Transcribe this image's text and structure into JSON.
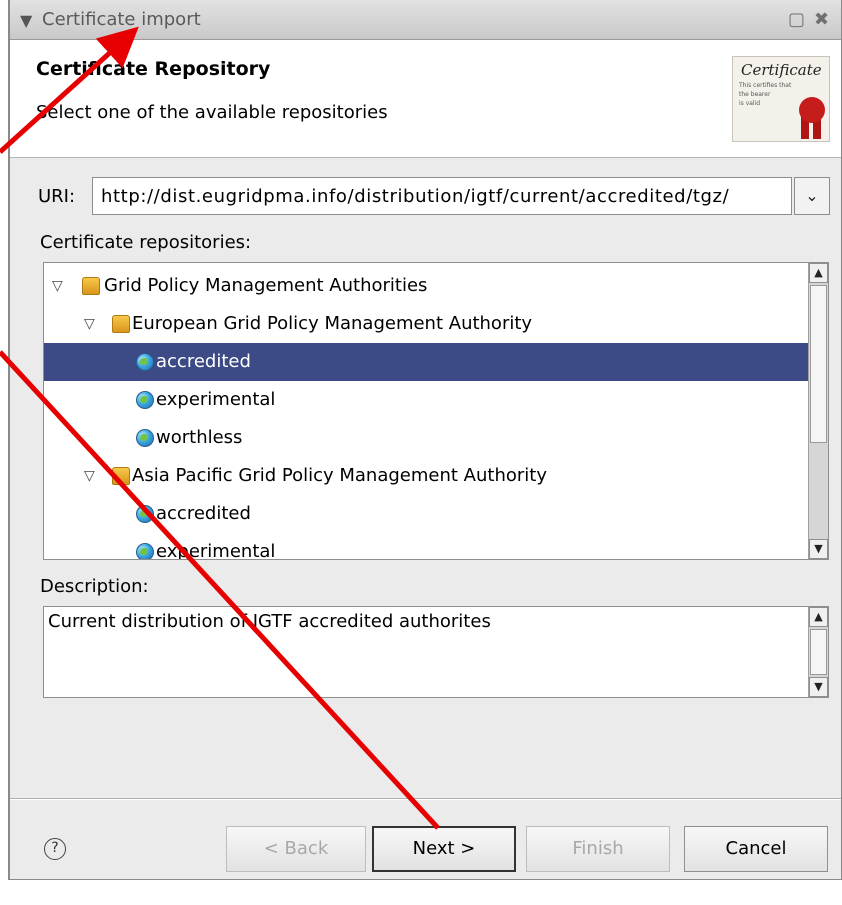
{
  "window": {
    "title": "Certificate import",
    "icons": [
      "chevron-down-icon",
      "maximize-icon",
      "close-icon"
    ]
  },
  "banner": {
    "title": "Certificate Repository",
    "subtitle": "Select one of the available repositories",
    "certificate_image": {
      "title": "Certificate",
      "body_lines": [
        "This certifies that",
        "the bearer",
        "is valid"
      ]
    }
  },
  "uri": {
    "label": "URI:",
    "value": "http://dist.eugridpma.info/distribution/igtf/current/accredited/tgz/"
  },
  "repositories": {
    "label": "Certificate repositories:",
    "items": [
      {
        "label": "Grid Policy Management Authorities",
        "icon": "folder-icon",
        "expanded": true,
        "level": 0,
        "selected": false
      },
      {
        "label": "European Grid Policy Management Authority",
        "icon": "folder-icon",
        "expanded": true,
        "level": 1,
        "selected": false
      },
      {
        "label": "accredited",
        "icon": "globe-icon",
        "level": 2,
        "selected": true
      },
      {
        "label": "experimental",
        "icon": "globe-icon",
        "level": 2,
        "selected": false
      },
      {
        "label": "worthless",
        "icon": "globe-icon",
        "level": 2,
        "selected": false
      },
      {
        "label": "Asia Pacific Grid Policy Management Authority",
        "icon": "folder-icon",
        "expanded": true,
        "level": 1,
        "selected": false
      },
      {
        "label": "accredited",
        "icon": "globe-icon",
        "level": 2,
        "selected": false
      },
      {
        "label": "experimental",
        "icon": "globe-icon",
        "level": 2,
        "selected": false
      }
    ]
  },
  "description": {
    "label": "Description:",
    "text": "Current distribution of IGTF accredited authorites"
  },
  "buttons": {
    "help": "?",
    "back": "< Back",
    "next": "Next >",
    "finish": "Finish",
    "cancel": "Cancel"
  },
  "colors": {
    "selection": "#3c4a86",
    "annotation_arrow": "#e60000"
  }
}
